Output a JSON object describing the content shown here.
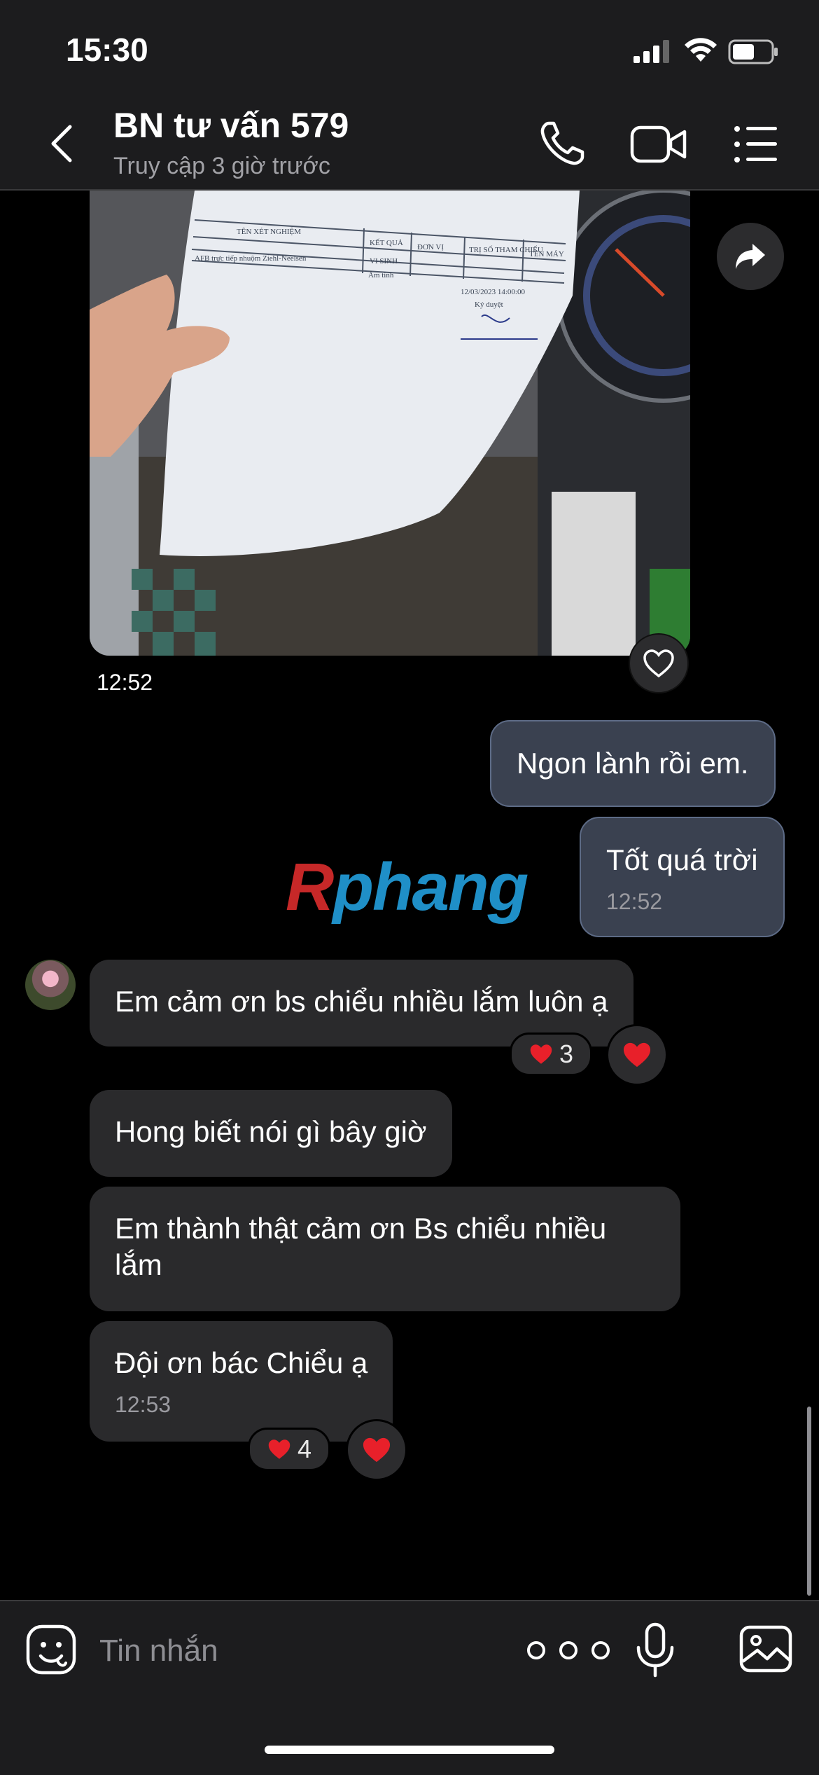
{
  "status_bar": {
    "time": "15:30",
    "icons": [
      "signal-icon",
      "wifi-icon",
      "battery-icon"
    ]
  },
  "header": {
    "title": "BN tư vấn 579",
    "subtitle": "Truy cập 3 giờ trước",
    "actions": [
      "back-icon",
      "phone-icon",
      "video-icon",
      "menu-icon"
    ]
  },
  "photo_message": {
    "time": "12:52",
    "document_heading": "TÊN XÉT NGHIỆM",
    "document_columns": [
      "KẾT QUẢ",
      "ĐƠN VỊ",
      "TRỊ SỐ THAM CHIẾU",
      "TÊN MÁY"
    ],
    "document_row_label": "VI SINH",
    "document_test": "AFB trực tiếp nhuộm Ziehl-Neelsen",
    "document_result": "Âm tính",
    "document_signature": "Ký duyệt",
    "document_date": "12/03/2023 14:00:00"
  },
  "messages": [
    {
      "direction": "out",
      "text": "Ngon lành rồi em."
    },
    {
      "direction": "out",
      "text": "Tốt quá trời",
      "time": "12:52"
    },
    {
      "direction": "in",
      "text": "Em cảm ơn bs chiểu nhiều lắm luôn ạ",
      "reaction_count": "3"
    },
    {
      "direction": "in",
      "text": "Hong biết nói gì bây giờ"
    },
    {
      "direction": "in",
      "text": "Em thành thật cảm ơn Bs chiểu nhiều lắm"
    },
    {
      "direction": "in",
      "text": "Đội ơn bác Chiểu ạ",
      "time": "12:53",
      "reaction_count": "4"
    }
  ],
  "watermark": {
    "part1": "R",
    "part2": "phang"
  },
  "colors": {
    "header_bg": "#1c1c1e",
    "outgoing_bubble": "#3a4150",
    "incoming_bubble": "#2a2a2c",
    "heart": "#e8202a"
  },
  "composer": {
    "placeholder": "Tin nhắn",
    "icons": [
      "sticker-icon",
      "more-icon",
      "microphone-icon",
      "gallery-icon"
    ]
  }
}
